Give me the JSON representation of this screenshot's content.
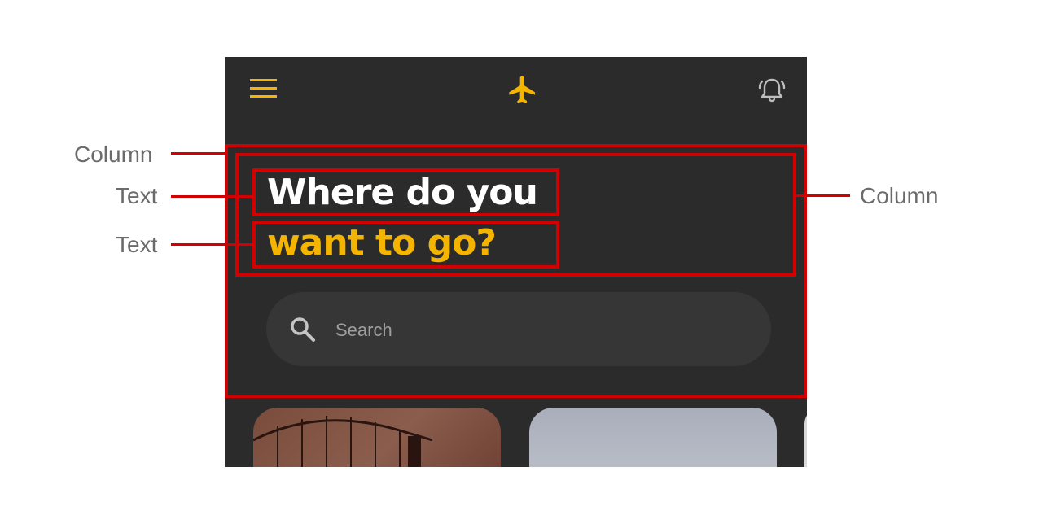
{
  "app": {
    "headline_line1": "Where do you",
    "headline_line2": "want to go?",
    "search_placeholder": "Search",
    "accent_color": "#f5b400",
    "icons": [
      "menu-icon",
      "airplane-icon",
      "alarm-bell-icon",
      "search-icon"
    ]
  },
  "annotations": {
    "outer_column": "Column",
    "inner_column": "Column",
    "text_1": "Text",
    "text_2": "Text"
  }
}
